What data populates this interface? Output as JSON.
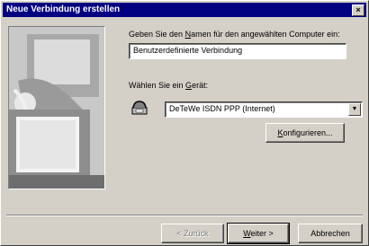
{
  "window": {
    "title": "Neue Verbindung erstellen",
    "close_glyph": "×"
  },
  "form": {
    "name_label_pre": "Geben Sie den ",
    "name_label_accel": "N",
    "name_label_post": "amen für den angewählten Computer ein:",
    "name_value": "Benutzerdefinierte Verbindung",
    "device_label_pre": "Wählen Sie ein ",
    "device_label_accel": "G",
    "device_label_post": "erät:",
    "device_value": "DeTeWe ISDN PPP (Internet)",
    "configure_accel": "K",
    "configure_rest": "onfigurieren..."
  },
  "footer": {
    "back_label": "< Zurück",
    "next_accel": "W",
    "next_rest": "eiter >",
    "cancel_label": "Abbrechen"
  },
  "icons": {
    "device": "phone-modem-icon",
    "dropdown": "dropdown-arrow-icon",
    "illustration": "computer-illustration"
  }
}
